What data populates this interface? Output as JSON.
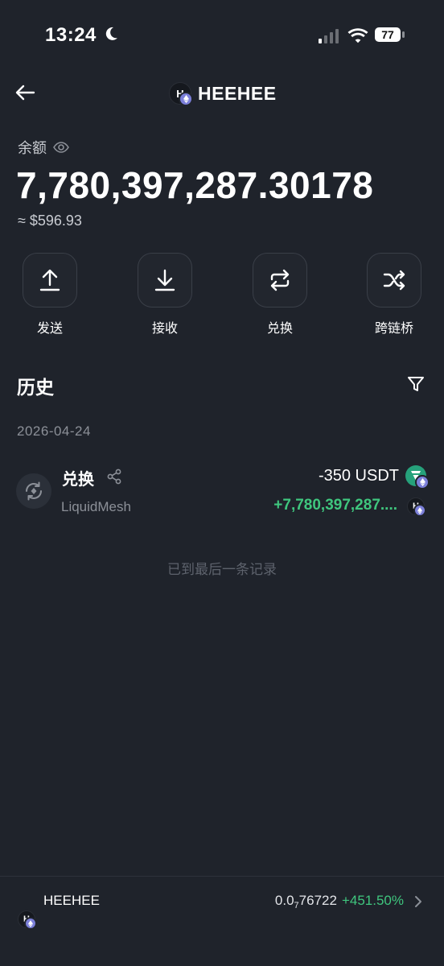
{
  "status_bar": {
    "time": "13:24",
    "battery": "77"
  },
  "header": {
    "title": "HEEHEE",
    "token_glyph": "H"
  },
  "balance": {
    "label": "余额",
    "amount": "7,780,397,287.30178",
    "usd_value": "≈ $596.93"
  },
  "actions": [
    {
      "label": "发送",
      "icon": "upload-icon"
    },
    {
      "label": "接收",
      "icon": "download-icon"
    },
    {
      "label": "兑换",
      "icon": "swap-icon"
    },
    {
      "label": "跨链桥",
      "icon": "shuffle-icon"
    }
  ],
  "history": {
    "title": "历史",
    "date": "2026-04-24",
    "transactions": [
      {
        "type": "兑换",
        "provider": "LiquidMesh",
        "sent": "-350 USDT",
        "received": "+7,780,397,287...."
      }
    ],
    "end_note": "已到最后一条记录"
  },
  "bottom_bar": {
    "name": "HEEHEE",
    "price_prefix": "0.0",
    "price_subscript": "7",
    "price_suffix": "76722",
    "change": "+451.50%"
  },
  "colors": {
    "background": "#1f232b",
    "positive": "#3fc67e",
    "muted": "#8c9098",
    "usdt": "#26a17b",
    "eth_badge": "#7b7fd9"
  }
}
